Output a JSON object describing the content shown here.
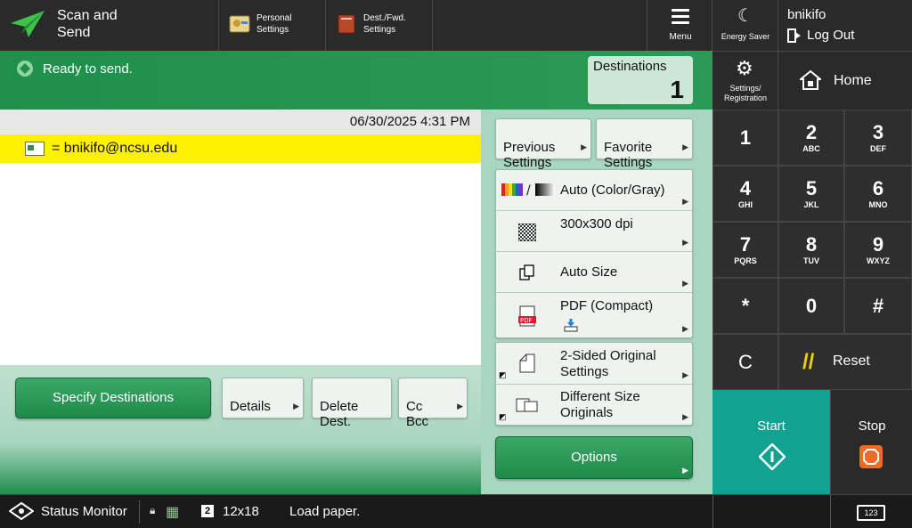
{
  "topbar": {
    "app_title": "Scan and\nSend",
    "personal_settings": "Personal\nSettings",
    "dest_fwd_settings": "Dest./Fwd.\nSettings",
    "menu": "Menu"
  },
  "system": {
    "energy_saver": "Energy Saver",
    "username": "bnikifo",
    "log_out": "Log Out",
    "settings_registration": "Settings/\nRegistration",
    "home": "Home"
  },
  "status": {
    "ready": "Ready to send.",
    "destinations_label": "Destinations",
    "destinations_count": "1"
  },
  "dest_list": {
    "datetime": "06/30/2025 4:31 PM",
    "rows": [
      {
        "text": "= bnikifo@ncsu.edu"
      }
    ]
  },
  "actions": {
    "specify_destinations": "Specify Destinations",
    "details": "Details",
    "delete_dest": "Delete\nDest.",
    "cc_bcc": "Cc\nBcc"
  },
  "settings": {
    "previous": "Previous\nSettings",
    "favorite": "Favorite\nSettings",
    "color": "Auto (Color/Gray)",
    "resolution": "300x300 dpi",
    "size": "Auto Size",
    "format": "PDF (Compact)",
    "two_sided": "2-Sided Original\nSettings",
    "diff_size": "Different Size\nOriginals",
    "options": "Options"
  },
  "keypad": {
    "keys": [
      {
        "num": "1",
        "sub": ""
      },
      {
        "num": "2",
        "sub": "ABC"
      },
      {
        "num": "3",
        "sub": "DEF"
      },
      {
        "num": "4",
        "sub": "GHI"
      },
      {
        "num": "5",
        "sub": "JKL"
      },
      {
        "num": "6",
        "sub": "MNO"
      },
      {
        "num": "7",
        "sub": "PQRS"
      },
      {
        "num": "8",
        "sub": "TUV"
      },
      {
        "num": "9",
        "sub": "WXYZ"
      },
      {
        "num": "*",
        "sub": ""
      },
      {
        "num": "0",
        "sub": ""
      },
      {
        "num": "#",
        "sub": ""
      }
    ],
    "clear": "C",
    "reset": "Reset",
    "start": "Start",
    "stop": "Stop"
  },
  "statusbar": {
    "status_monitor": "Status Monitor",
    "tray": "2",
    "paper_size": "12x18",
    "message": "Load paper.",
    "keyboard": "123"
  },
  "colors": {
    "brand_green": "#1f8f4c",
    "start_teal": "#12a293",
    "highlight_yellow": "#fff200",
    "stop_orange": "#f06a2a"
  },
  "icons": {
    "app": "paper-plane-icon",
    "personal": "personal-settings-icon",
    "dest_fwd": "book-icon",
    "menu": "hamburger-icon",
    "energy": "moon-icon",
    "logout": "logout-icon",
    "settings": "gear-icon",
    "home": "house-icon"
  }
}
